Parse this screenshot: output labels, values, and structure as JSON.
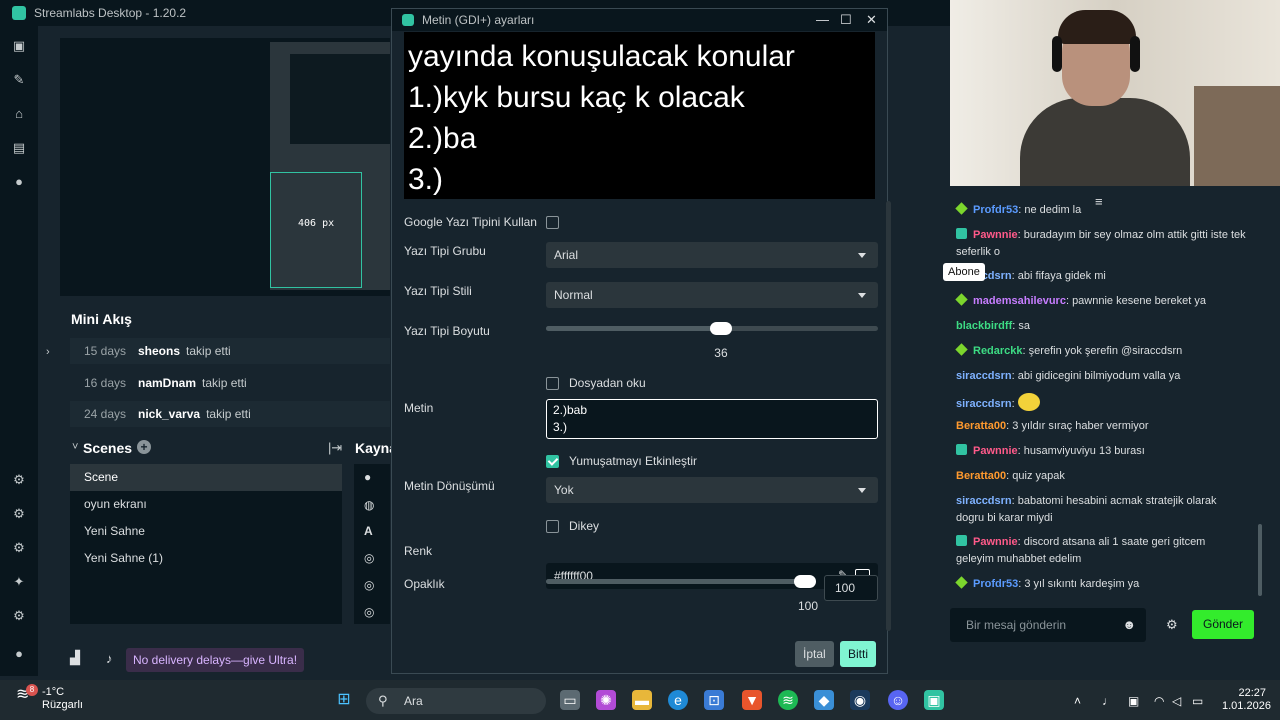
{
  "app": {
    "title": "Streamlabs Desktop - 1.20.2"
  },
  "editor": {
    "px_label": "406 px"
  },
  "mini_feed": {
    "title": "Mini Akış",
    "rows": [
      {
        "days": "15 days",
        "user": "sheons",
        "action": "takip etti"
      },
      {
        "days": "16 days",
        "user": "namDnam",
        "action": "takip etti"
      },
      {
        "days": "24 days",
        "user": "nick_varva",
        "action": "takip etti"
      }
    ]
  },
  "scenes": {
    "title": "Scenes",
    "items": [
      "Scene",
      "oyun ekranı",
      "Yeni Sahne",
      "Yeni Sahne (1)"
    ]
  },
  "sources": {
    "title": "Kayna"
  },
  "promo": {
    "text": "No delivery delays—give Ultra!"
  },
  "dialog": {
    "title": "Metin (GDI+) ayarları",
    "preview_lines": [
      "yayında konuşulacak konular",
      "1.)kyk bursu kaç k olacak",
      "2.)ba",
      "3.)"
    ],
    "google_font_label": "Google Yazı Tipini Kullan",
    "font_family_label": "Yazı Tipi Grubu",
    "font_family_value": "Arial",
    "font_style_label": "Yazı Tipi Stili",
    "font_style_value": "Normal",
    "font_size_label": "Yazı Tipi Boyutu",
    "font_size_value": "36",
    "font_size_fraction": 0.53,
    "from_file_label": "Dosyadan oku",
    "text_label": "Metin",
    "text_lines": [
      "2.)bab",
      "3.)"
    ],
    "antialias_label": "Yumuşatmayı Etkinleştir",
    "transform_label": "Metin Dönüşümü",
    "transform_value": "Yok",
    "vertical_label": "Dikey",
    "color_label": "Renk",
    "color_value": "#ffffff00",
    "opacity_label": "Opaklık",
    "opacity_value": "100",
    "opacity_fraction": 1.0,
    "cancel_label": "İptal",
    "done_label": "Bitti"
  },
  "chat": {
    "tooltip": "Abone",
    "messages": [
      {
        "badge": "vip",
        "name": "Profdr53",
        "color": "#5b9bff",
        "text": "ne dedim la"
      },
      {
        "badge": "sub",
        "name": "Pawnnie",
        "color": "#ff5a8a",
        "text": "buradayım bir sey olmaz olm attik gitti iste tek seferlik o"
      },
      {
        "badge": "",
        "name": "siraccdsrn",
        "color": "#7fb2ff",
        "text": "abi fifaya gidek mi"
      },
      {
        "badge": "vip",
        "name": "mademsahilevurc",
        "color": "#c77dff",
        "text": "pawnnie kesene bereket ya"
      },
      {
        "badge": "",
        "name": "blackbirdff",
        "color": "#3ddc84",
        "text": "sa"
      },
      {
        "badge": "vip",
        "name": "Redarckk",
        "color": "#3ddc84",
        "text": "şerefin yok şerefin @siraccdsrn"
      },
      {
        "badge": "",
        "name": "siraccdsrn",
        "color": "#7fb2ff",
        "text": "abi gidicegini bilmiyodum valla ya"
      },
      {
        "badge": "",
        "name": "siraccdsrn",
        "color": "#7fb2ff",
        "text": ""
      },
      {
        "badge": "",
        "name": "Beratta00",
        "color": "#ff9a2e",
        "text": "3 yıldır sıraç haber vermiyor"
      },
      {
        "badge": "sub",
        "name": "Pawnnie",
        "color": "#ff5a8a",
        "text": "husamviyuviyu 13 burası"
      },
      {
        "badge": "",
        "name": "Beratta00",
        "color": "#ff9a2e",
        "text": "quiz yapak"
      },
      {
        "badge": "",
        "name": "siraccdsrn",
        "color": "#7fb2ff",
        "text": "babatomi hesabini acmak stratejik olarak dogru bi karar miydi"
      },
      {
        "badge": "sub",
        "name": "Pawnnie",
        "color": "#ff5a8a",
        "text": "discord atsana ali 1 saate geri gitcem geleyim muhabbet edelim"
      },
      {
        "badge": "vip",
        "name": "Profdr53",
        "color": "#5b9bff",
        "text": "3 yıl sıkıntı kardeşim ya"
      }
    ],
    "input_placeholder": "Bir mesaj gönderin",
    "send_label": "Gönder"
  },
  "taskbar": {
    "weather_temp": "-1°C",
    "weather_desc": "Rüzgarlı",
    "weather_badge": "8",
    "search_label": "Ara",
    "time": "22:27",
    "date": "1.01.2026"
  }
}
